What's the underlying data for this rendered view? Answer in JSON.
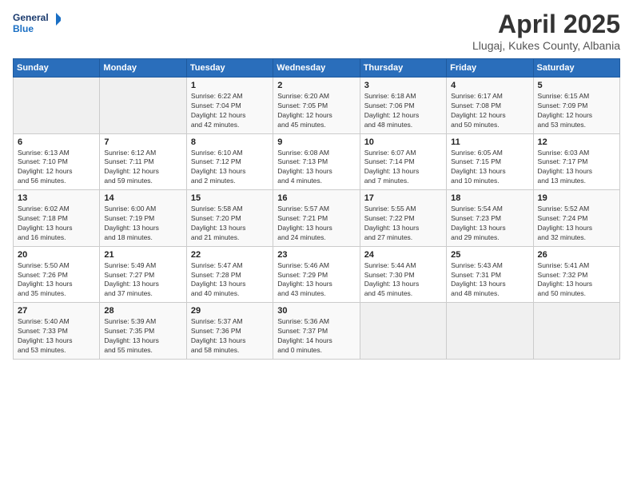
{
  "logo": {
    "line1": "General",
    "line2": "Blue"
  },
  "title": "April 2025",
  "subtitle": "Llugaj, Kukes County, Albania",
  "days_of_week": [
    "Sunday",
    "Monday",
    "Tuesday",
    "Wednesday",
    "Thursday",
    "Friday",
    "Saturday"
  ],
  "weeks": [
    [
      {
        "day": "",
        "info": ""
      },
      {
        "day": "",
        "info": ""
      },
      {
        "day": "1",
        "info": "Sunrise: 6:22 AM\nSunset: 7:04 PM\nDaylight: 12 hours\nand 42 minutes."
      },
      {
        "day": "2",
        "info": "Sunrise: 6:20 AM\nSunset: 7:05 PM\nDaylight: 12 hours\nand 45 minutes."
      },
      {
        "day": "3",
        "info": "Sunrise: 6:18 AM\nSunset: 7:06 PM\nDaylight: 12 hours\nand 48 minutes."
      },
      {
        "day": "4",
        "info": "Sunrise: 6:17 AM\nSunset: 7:08 PM\nDaylight: 12 hours\nand 50 minutes."
      },
      {
        "day": "5",
        "info": "Sunrise: 6:15 AM\nSunset: 7:09 PM\nDaylight: 12 hours\nand 53 minutes."
      }
    ],
    [
      {
        "day": "6",
        "info": "Sunrise: 6:13 AM\nSunset: 7:10 PM\nDaylight: 12 hours\nand 56 minutes."
      },
      {
        "day": "7",
        "info": "Sunrise: 6:12 AM\nSunset: 7:11 PM\nDaylight: 12 hours\nand 59 minutes."
      },
      {
        "day": "8",
        "info": "Sunrise: 6:10 AM\nSunset: 7:12 PM\nDaylight: 13 hours\nand 2 minutes."
      },
      {
        "day": "9",
        "info": "Sunrise: 6:08 AM\nSunset: 7:13 PM\nDaylight: 13 hours\nand 4 minutes."
      },
      {
        "day": "10",
        "info": "Sunrise: 6:07 AM\nSunset: 7:14 PM\nDaylight: 13 hours\nand 7 minutes."
      },
      {
        "day": "11",
        "info": "Sunrise: 6:05 AM\nSunset: 7:15 PM\nDaylight: 13 hours\nand 10 minutes."
      },
      {
        "day": "12",
        "info": "Sunrise: 6:03 AM\nSunset: 7:17 PM\nDaylight: 13 hours\nand 13 minutes."
      }
    ],
    [
      {
        "day": "13",
        "info": "Sunrise: 6:02 AM\nSunset: 7:18 PM\nDaylight: 13 hours\nand 16 minutes."
      },
      {
        "day": "14",
        "info": "Sunrise: 6:00 AM\nSunset: 7:19 PM\nDaylight: 13 hours\nand 18 minutes."
      },
      {
        "day": "15",
        "info": "Sunrise: 5:58 AM\nSunset: 7:20 PM\nDaylight: 13 hours\nand 21 minutes."
      },
      {
        "day": "16",
        "info": "Sunrise: 5:57 AM\nSunset: 7:21 PM\nDaylight: 13 hours\nand 24 minutes."
      },
      {
        "day": "17",
        "info": "Sunrise: 5:55 AM\nSunset: 7:22 PM\nDaylight: 13 hours\nand 27 minutes."
      },
      {
        "day": "18",
        "info": "Sunrise: 5:54 AM\nSunset: 7:23 PM\nDaylight: 13 hours\nand 29 minutes."
      },
      {
        "day": "19",
        "info": "Sunrise: 5:52 AM\nSunset: 7:24 PM\nDaylight: 13 hours\nand 32 minutes."
      }
    ],
    [
      {
        "day": "20",
        "info": "Sunrise: 5:50 AM\nSunset: 7:26 PM\nDaylight: 13 hours\nand 35 minutes."
      },
      {
        "day": "21",
        "info": "Sunrise: 5:49 AM\nSunset: 7:27 PM\nDaylight: 13 hours\nand 37 minutes."
      },
      {
        "day": "22",
        "info": "Sunrise: 5:47 AM\nSunset: 7:28 PM\nDaylight: 13 hours\nand 40 minutes."
      },
      {
        "day": "23",
        "info": "Sunrise: 5:46 AM\nSunset: 7:29 PM\nDaylight: 13 hours\nand 43 minutes."
      },
      {
        "day": "24",
        "info": "Sunrise: 5:44 AM\nSunset: 7:30 PM\nDaylight: 13 hours\nand 45 minutes."
      },
      {
        "day": "25",
        "info": "Sunrise: 5:43 AM\nSunset: 7:31 PM\nDaylight: 13 hours\nand 48 minutes."
      },
      {
        "day": "26",
        "info": "Sunrise: 5:41 AM\nSunset: 7:32 PM\nDaylight: 13 hours\nand 50 minutes."
      }
    ],
    [
      {
        "day": "27",
        "info": "Sunrise: 5:40 AM\nSunset: 7:33 PM\nDaylight: 13 hours\nand 53 minutes."
      },
      {
        "day": "28",
        "info": "Sunrise: 5:39 AM\nSunset: 7:35 PM\nDaylight: 13 hours\nand 55 minutes."
      },
      {
        "day": "29",
        "info": "Sunrise: 5:37 AM\nSunset: 7:36 PM\nDaylight: 13 hours\nand 58 minutes."
      },
      {
        "day": "30",
        "info": "Sunrise: 5:36 AM\nSunset: 7:37 PM\nDaylight: 14 hours\nand 0 minutes."
      },
      {
        "day": "",
        "info": ""
      },
      {
        "day": "",
        "info": ""
      },
      {
        "day": "",
        "info": ""
      }
    ]
  ]
}
